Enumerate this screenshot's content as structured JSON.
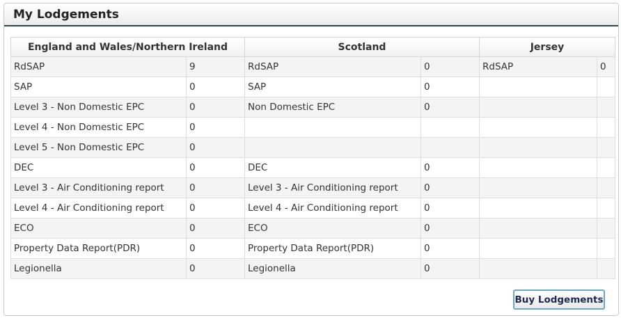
{
  "panel": {
    "title": "My Lodgements"
  },
  "table": {
    "headers": [
      "England and Wales/Northern Ireland",
      "Scotland",
      "Jersey"
    ],
    "rows": [
      [
        "RdSAP",
        "9",
        "RdSAP",
        "0",
        "RdSAP",
        "0"
      ],
      [
        "SAP",
        "0",
        "SAP",
        "0",
        "",
        ""
      ],
      [
        "Level 3 - Non Domestic EPC",
        "0",
        "Non Domestic EPC",
        "0",
        "",
        ""
      ],
      [
        "Level 4 - Non Domestic EPC",
        "0",
        "",
        "",
        "",
        ""
      ],
      [
        "Level 5 - Non Domestic EPC",
        "0",
        "",
        "",
        "",
        ""
      ],
      [
        "DEC",
        "0",
        "DEC",
        "0",
        "",
        ""
      ],
      [
        "Level 3 - Air Conditioning report",
        "0",
        "Level 3 - Air Conditioning report",
        "0",
        "",
        ""
      ],
      [
        "Level 4 - Air Conditioning report",
        "0",
        "Level 4 - Air Conditioning report",
        "0",
        "",
        ""
      ],
      [
        "ECO",
        "0",
        "ECO",
        "0",
        "",
        ""
      ],
      [
        "Property Data Report(PDR)",
        "0",
        "Property Data Report(PDR)",
        "0",
        "",
        ""
      ],
      [
        "Legionella",
        "0",
        "Legionella",
        "0",
        "",
        ""
      ]
    ]
  },
  "actions": {
    "buy_label": "Buy Lodgements"
  },
  "colors": {
    "header_rule": "#2b4a42",
    "button_border": "#6aa7c7",
    "row_stripe": "#f4f4f4"
  }
}
